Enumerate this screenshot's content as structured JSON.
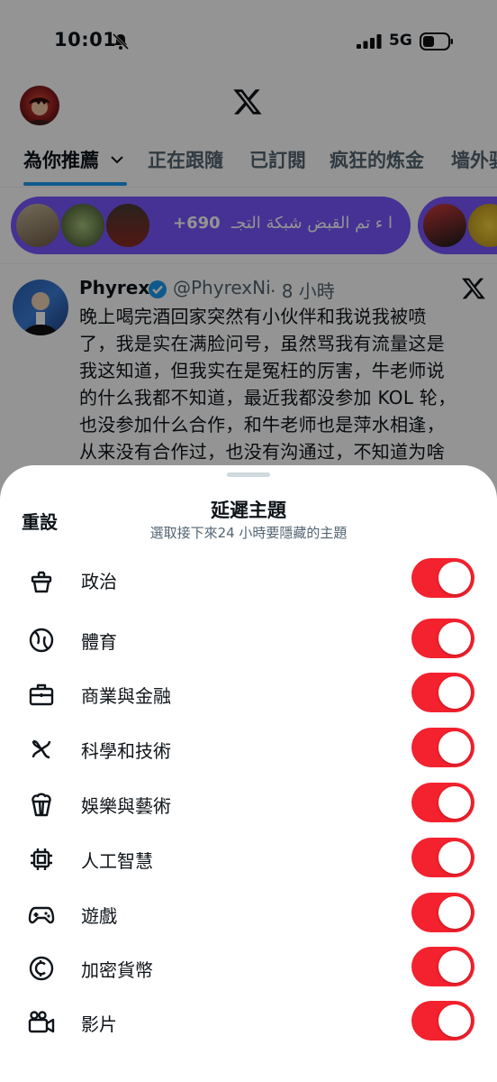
{
  "status": {
    "time": "10:01",
    "network": "5G"
  },
  "tabs": [
    "為你推薦",
    "正在跟隨",
    "已訂閱",
    "疯狂的炼金",
    "墙外骡"
  ],
  "spaces": {
    "count": "+690",
    "title": "ا ء تم القبض شبكة التجـ"
  },
  "tweet": {
    "name": "Phyrex",
    "handle": "@PhyrexNi",
    "time": "· 8 小時",
    "lines": [
      "晚上喝完酒回家突然有小伙伴和我说我被喷",
      "了，我是实在满脸问号，虽然骂我有流量这是",
      "我这知道，但我实在是冤枉的厉害，牛老师说",
      "的什么我都不知道，最近我都没参加 KOL 轮，",
      "也没参加什么合作，和牛老师也是萍水相逢，",
      "从来没有合作过，也没有沟通过，不知道为啥"
    ]
  },
  "sheet": {
    "reset": "重設",
    "title": "延遲主題",
    "subtitle": "選取接下來24 小時要隱藏的主題",
    "topics": [
      {
        "label": "政治",
        "icon": "podium-icon",
        "on": true
      },
      {
        "label": "體育",
        "icon": "baseball-icon",
        "on": true
      },
      {
        "label": "商業與金融",
        "icon": "briefcase-icon",
        "on": true
      },
      {
        "label": "科學和技術",
        "icon": "atom-icon",
        "on": true
      },
      {
        "label": "娛樂與藝術",
        "icon": "popcorn-icon",
        "on": true
      },
      {
        "label": "人工智慧",
        "icon": "chip-icon",
        "on": true
      },
      {
        "label": "遊戲",
        "icon": "gamepad-icon",
        "on": true
      },
      {
        "label": "加密貨幣",
        "icon": "crypto-coin-icon",
        "on": true
      },
      {
        "label": "影片",
        "icon": "video-camera-icon",
        "on": true
      }
    ]
  },
  "colors": {
    "toggle_on": "#f4212e",
    "accent": "#1d9bf0",
    "spaces": "#7856ff"
  }
}
